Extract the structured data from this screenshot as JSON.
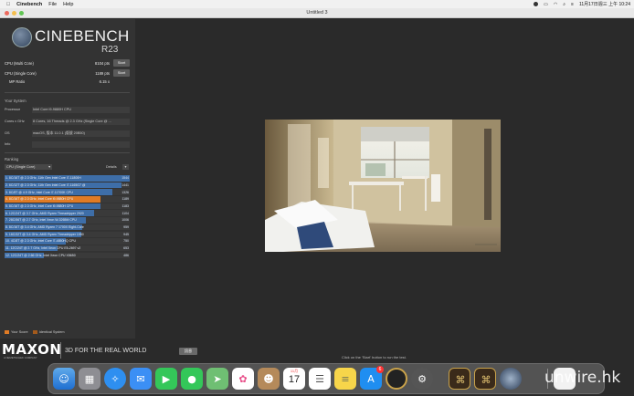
{
  "menubar": {
    "app_name": "Cinebench",
    "items": [
      "File",
      "Help"
    ],
    "clock": "11月17日週三 上午 10:24"
  },
  "window": {
    "title": "Untitled 3"
  },
  "logo": {
    "name": "CINEBENCH",
    "version": "R23"
  },
  "scores": [
    {
      "label": "CPU (Multi Core)",
      "value": "8104 pts",
      "button": "Start"
    },
    {
      "label": "CPU (Single Core)",
      "value": "1189 pts",
      "button": "Start"
    },
    {
      "label": "MP Ratio",
      "value": "6.15 x",
      "button": ""
    }
  ],
  "system": {
    "title": "Your System",
    "rows": [
      {
        "key": "Processor",
        "value": "Intel Core i9-9880H CPU"
      },
      {
        "key": "Cores x GHz",
        "value": "8 Cores, 16 Threads @ 2.3 GHz (Single Core @ ..."
      },
      {
        "key": "OS",
        "value": "macOS, 版本 11.0.1 (版號 20B50)"
      },
      {
        "key": "Info",
        "value": ""
      }
    ]
  },
  "ranking": {
    "title": "Ranking",
    "selector": "CPU (Single Core)",
    "details": "Details",
    "rows": [
      {
        "label": "1. 8C/16T @ 2.3 GHz, 11th Gen Intel Core i7-11800H",
        "score": "1544",
        "pct": 1.0,
        "highlight": false
      },
      {
        "label": "2. 6C/12T @ 2.3 GHz, 11th Gen Intel Core i7-1165G7 @",
        "score": "1441",
        "pct": 0.933,
        "highlight": false
      },
      {
        "label": "3. 8C/8T @ 4.9 GHz, Intel Core i7-11700K CPU",
        "score": "1326",
        "pct": 0.859,
        "highlight": false
      },
      {
        "label": "4. 8C/16T @ 2.3 GHz, Intel Core i9-9880H CPU",
        "score": "1189",
        "pct": 0.77,
        "highlight": true
      },
      {
        "label": "5. 8C/16T @ 2.3 GHz, Intel Core i9-9880H CPU",
        "score": "1183",
        "pct": 0.766,
        "highlight": false
      },
      {
        "label": "6. 12C/24T @ 3.7 GHz, AMD Ryzen Threadripper 2920",
        "score": "1104",
        "pct": 0.715,
        "highlight": false
      },
      {
        "label": "7. 28C/56T @ 2.7 GHz, Intel Xeon W-3265M CPU",
        "score": "1006",
        "pct": 0.652,
        "highlight": false
      },
      {
        "label": "8. 8C/16T @ 3.4 GHz, AMD Ryzen 7 1700X Eight-Core",
        "score": "959",
        "pct": 0.621,
        "highlight": false
      },
      {
        "label": "9. 16C/32T @ 3.4 GHz, AMD Ryzen Threadripper 1950",
        "score": "945",
        "pct": 0.612,
        "highlight": false
      },
      {
        "label": "10. 4C/8T @ 2.3 GHz, Intel Core i7-4850HQ CPU",
        "score": "750",
        "pct": 0.486,
        "highlight": false
      },
      {
        "label": "11. 12C/24T @ 2.7 GHz, Intel Xeon CPU E5-2697 v2",
        "score": "653",
        "pct": 0.423,
        "highlight": false
      },
      {
        "label": "12. 12C/24T @ 2.66 GHz, Intel Xeon CPU X5650",
        "score": "486",
        "pct": 0.315,
        "highlight": false
      }
    ]
  },
  "legend": {
    "your_score": "Your Score",
    "identical": "Identical System",
    "your_color": "#e07b25",
    "identical_color": "#a35a1c"
  },
  "footer": {
    "brand": "MAXON",
    "brand_sub": "A NEMETSCHEK COMPANY",
    "tagline": "3D FOR THE REAL WORLD",
    "hint": "Click on the 'Start' button to run the test.",
    "tooltip": "訊息"
  },
  "dock": {
    "apps": [
      "finder-icon",
      "launchpad-icon",
      "safari-icon",
      "mail-icon",
      "facetime-icon",
      "messages-icon",
      "maps-icon",
      "photos-icon",
      "contacts-icon",
      "calendar-icon",
      "reminders-icon",
      "notes-icon",
      "app-store-icon",
      "cinema-icon",
      "system-preferences-icon",
      "game1-icon",
      "game2-icon",
      "cinebench-icon",
      "documents-icon",
      "trash-icon"
    ],
    "calendar_month": "11月",
    "calendar_day": "17",
    "app_store_badge": "6"
  },
  "watermark": "unwire.hk"
}
